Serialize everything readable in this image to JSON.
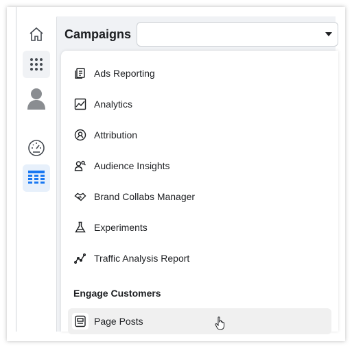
{
  "header": {
    "title": "Campaigns"
  },
  "campaign_select": {
    "value": ""
  },
  "rail": {
    "items": [
      {
        "name": "home-icon"
      },
      {
        "name": "apps-grid-icon"
      },
      {
        "name": "profile-icon"
      },
      {
        "name": "gauge-icon"
      },
      {
        "name": "table-icon"
      }
    ],
    "accent": "#1877f2"
  },
  "menu": {
    "items": [
      {
        "label": "Ads Reporting",
        "icon": "ads-reporting-icon"
      },
      {
        "label": "Analytics",
        "icon": "analytics-icon"
      },
      {
        "label": "Attribution",
        "icon": "attribution-icon"
      },
      {
        "label": "Audience Insights",
        "icon": "audience-insights-icon"
      },
      {
        "label": "Brand Collabs Manager",
        "icon": "handshake-icon"
      },
      {
        "label": "Experiments",
        "icon": "flask-icon"
      },
      {
        "label": "Traffic Analysis Report",
        "icon": "traffic-icon"
      }
    ],
    "section_heading": "Engage Customers",
    "engage_items": [
      {
        "label": "Page Posts",
        "icon": "page-posts-icon"
      }
    ]
  }
}
